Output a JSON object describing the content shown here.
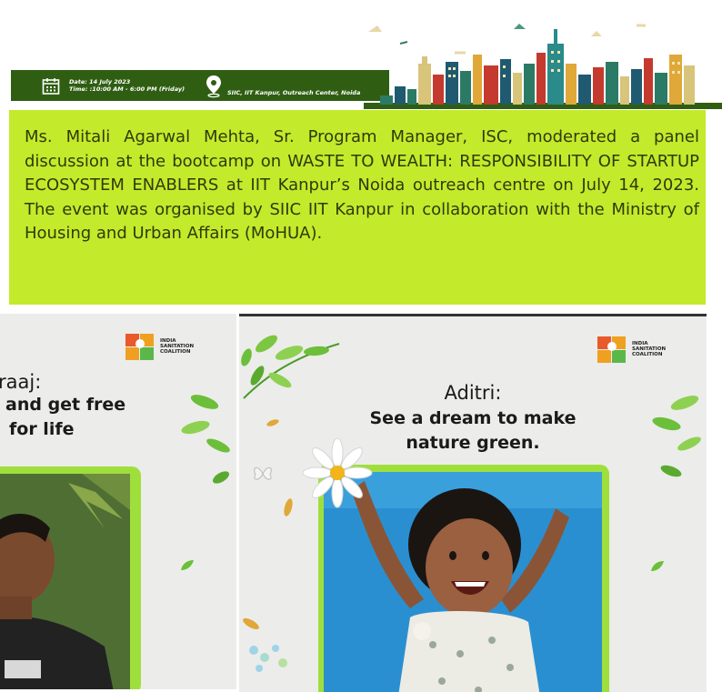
{
  "banner": {
    "date_line": "Date: 14 July 2023",
    "time_line": "Time: :10:00 AM - 6:00 PM (Friday)",
    "location": "SIIC, IIT Kanpur, Outreach Center, Noida",
    "icons": [
      "calendar-icon",
      "location-pin-icon"
    ]
  },
  "article": {
    "text": "Ms. Mitali Agarwal Mehta, Sr. Program Manager, ISC, moderated a panel discussion at the bootcamp on WASTE TO WEALTH: RESPONSIBILITY OF STARTUP ECOSYSTEM ENABLERS at IIT Kanpur’s Noida outreach centre on July 14, 2023. The event was organised by SIIC IIT Kanpur in collaboration with the Ministry of Housing and Urban Affairs (MoHUA)."
  },
  "cards": [
    {
      "logo_text": [
        "INDIA",
        "SANITATION",
        "COALITION"
      ],
      "name": "raaj:",
      "quote_lines": [
        "and get free",
        "for life"
      ]
    },
    {
      "logo_text": [
        "INDIA",
        "SANITATION",
        "COALITION"
      ],
      "name": "Aditri:",
      "quote_lines": [
        "See a dream to make",
        "nature green."
      ]
    }
  ],
  "colors": {
    "banner_strip": "#2f5e12",
    "infobox_bg": "#c4ea2c",
    "infobox_text": "#2f3b08",
    "photo_frame": "#9fdf3c"
  }
}
